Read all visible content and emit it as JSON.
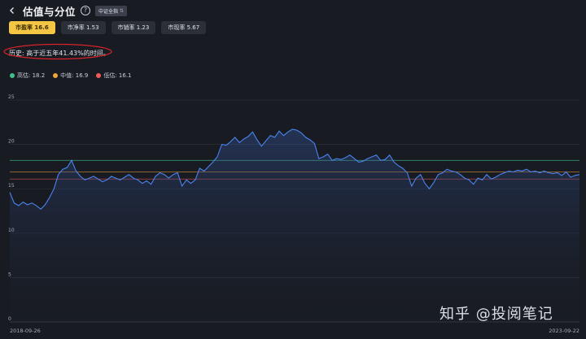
{
  "header": {
    "title": "估值与分位",
    "help_symbol": "?",
    "index_badge": "中证全指",
    "swap_symbol": "⇅"
  },
  "tabs": [
    {
      "label": "市盈率 16.6",
      "active": true
    },
    {
      "label": "市净率 1.53",
      "active": false
    },
    {
      "label": "市销率 1.23",
      "active": false
    },
    {
      "label": "市现率 5.67",
      "active": false
    }
  ],
  "history_text": "历史: 高于近五年41.43%的时间。",
  "legend": [
    {
      "label": "高估: 18.2",
      "color": "#3fc08c"
    },
    {
      "label": "中值: 16.9",
      "color": "#f0a53a"
    },
    {
      "label": "低估: 16.1",
      "color": "#f05a5a"
    }
  ],
  "watermark": "知乎 @投阅笔记",
  "colors": {
    "line": "#4a84f0",
    "high": "#3fc08c",
    "mid": "#f0a53a",
    "low": "#f05a5a",
    "annotation": "#d8232a"
  },
  "chart_data": {
    "type": "line",
    "title": "",
    "xlabel": "",
    "ylabel": "",
    "ylim": [
      0,
      25
    ],
    "yticks": [
      "0",
      "5",
      "10",
      "15",
      "20",
      "25"
    ],
    "x_start_label": "2018-09-26",
    "x_end_label": "2023-09-22",
    "reference_lines": [
      {
        "name": "高估",
        "value": 18.2
      },
      {
        "name": "中值",
        "value": 16.9
      },
      {
        "name": "低估",
        "value": 16.1
      }
    ],
    "series": [
      {
        "name": "市盈率",
        "values": [
          14.6,
          13.4,
          13.1,
          13.5,
          13.2,
          13.4,
          13.1,
          12.7,
          13.2,
          14.0,
          15.0,
          16.6,
          17.2,
          17.4,
          18.2,
          17.0,
          16.4,
          16.0,
          16.2,
          16.4,
          16.1,
          15.8,
          16.0,
          16.4,
          16.2,
          16.0,
          16.3,
          16.6,
          16.2,
          16.0,
          15.6,
          15.9,
          15.5,
          16.4,
          16.8,
          16.6,
          16.2,
          16.6,
          16.8,
          15.3,
          16.0,
          15.6,
          16.0,
          17.3,
          17.0,
          17.5,
          18.0,
          18.6,
          20.0,
          19.9,
          20.3,
          20.8,
          20.2,
          20.6,
          20.9,
          21.4,
          20.5,
          19.8,
          20.4,
          21.0,
          20.8,
          21.5,
          21.0,
          21.4,
          21.7,
          21.6,
          21.3,
          20.8,
          20.5,
          20.1,
          18.4,
          18.6,
          18.9,
          18.2,
          18.4,
          18.3,
          18.5,
          18.8,
          18.4,
          18.0,
          18.1,
          18.4,
          18.6,
          18.8,
          18.2,
          18.3,
          18.8,
          18.0,
          17.6,
          17.3,
          16.8,
          15.3,
          16.2,
          16.6,
          15.6,
          15.0,
          15.7,
          16.6,
          16.8,
          17.2,
          17.0,
          16.9,
          16.6,
          16.2,
          16.0,
          15.5,
          16.2,
          16.0,
          16.6,
          16.1,
          16.3,
          16.6,
          16.8,
          17.0,
          16.9,
          17.1,
          17.0,
          17.2,
          16.9,
          17.0,
          16.8,
          17.0,
          16.8,
          16.7,
          16.8,
          16.5,
          16.9,
          16.3,
          16.5,
          16.6
        ]
      }
    ]
  }
}
